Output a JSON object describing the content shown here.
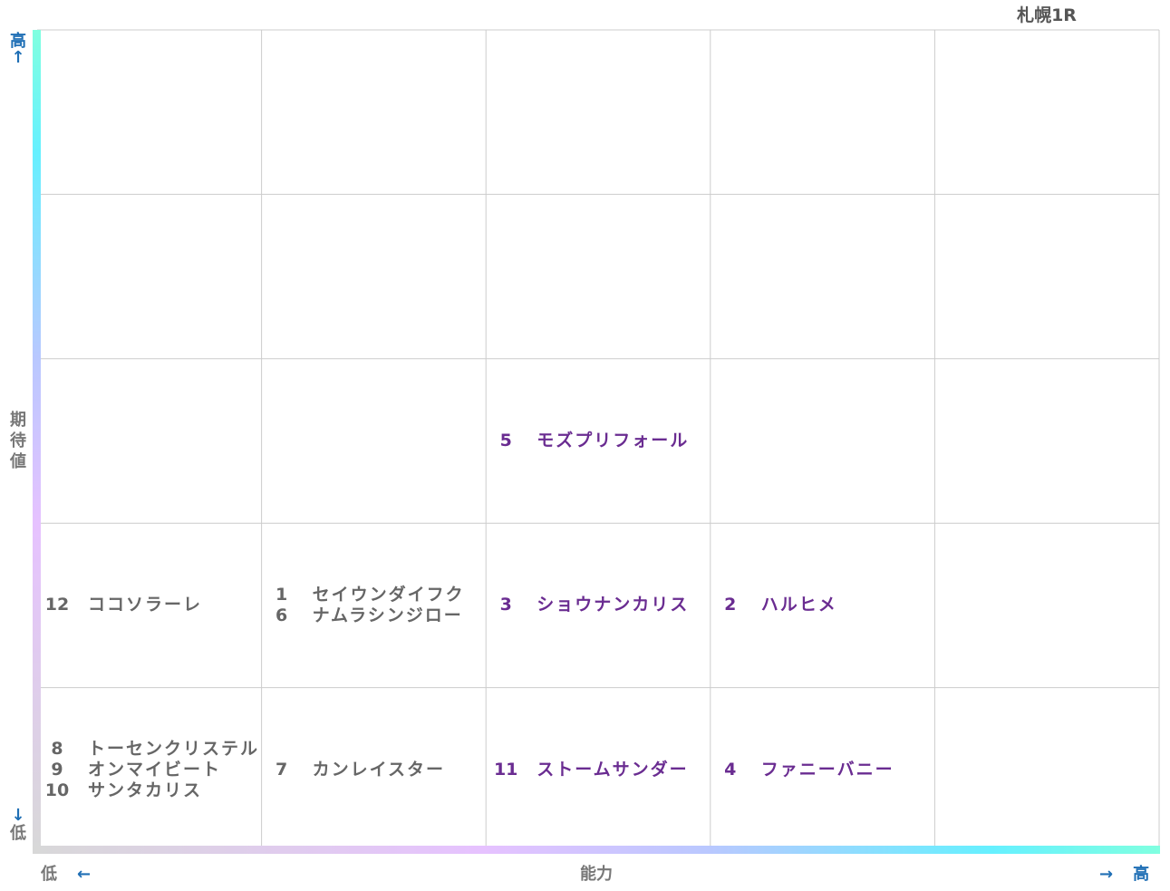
{
  "title": "札幌1R",
  "colors": {
    "grid": "#cccccc",
    "high_tier_text": "#6a2c91",
    "low_tier_text": "#666666",
    "axis_arrow_blue": "#1f6fb5",
    "axis_label_gray": "#777777",
    "gradient": [
      "#d8d8d8",
      "#e6c2ff",
      "#b9c8ff",
      "#66f0ff",
      "#80ffe0"
    ]
  },
  "axes": {
    "y": {
      "high": "高",
      "up_arrow": "↑",
      "label": [
        "期",
        "待",
        "値"
      ],
      "down_arrow": "↓",
      "low": "低"
    },
    "x": {
      "low": "低",
      "left_arrow": "←",
      "label": "能力",
      "right_arrow": "→",
      "high": "高"
    }
  },
  "chart_data": {
    "type": "table",
    "title": "札幌1R",
    "xlabel": "能力",
    "ylabel": "期待値",
    "columns": 5,
    "rows": 5,
    "cells": [
      {
        "col": 3,
        "row": 3,
        "tier": "high",
        "entries": [
          {
            "num": "5",
            "name": "モズプリフォール"
          }
        ]
      },
      {
        "col": 1,
        "row": 4,
        "tier": "low",
        "entries": [
          {
            "num": "12",
            "name": "ココソラーレ"
          }
        ]
      },
      {
        "col": 2,
        "row": 4,
        "tier": "low",
        "entries": [
          {
            "num": "1",
            "name": "セイウンダイフク"
          },
          {
            "num": "6",
            "name": "ナムラシンジロー"
          }
        ]
      },
      {
        "col": 3,
        "row": 4,
        "tier": "high",
        "entries": [
          {
            "num": "3",
            "name": "ショウナンカリス"
          }
        ]
      },
      {
        "col": 4,
        "row": 4,
        "tier": "high",
        "entries": [
          {
            "num": "2",
            "name": "ハルヒメ"
          }
        ]
      },
      {
        "col": 1,
        "row": 5,
        "tier": "low",
        "entries": [
          {
            "num": "8",
            "name": "トーセンクリステル"
          },
          {
            "num": "9",
            "name": "オンマイビート"
          },
          {
            "num": "10",
            "name": "サンタカリス"
          }
        ]
      },
      {
        "col": 2,
        "row": 5,
        "tier": "low",
        "entries": [
          {
            "num": "7",
            "name": "カンレイスター"
          }
        ]
      },
      {
        "col": 3,
        "row": 5,
        "tier": "high",
        "entries": [
          {
            "num": "11",
            "name": "ストームサンダー"
          }
        ]
      },
      {
        "col": 4,
        "row": 5,
        "tier": "high",
        "entries": [
          {
            "num": "4",
            "name": "ファニーバニー"
          }
        ]
      }
    ]
  }
}
